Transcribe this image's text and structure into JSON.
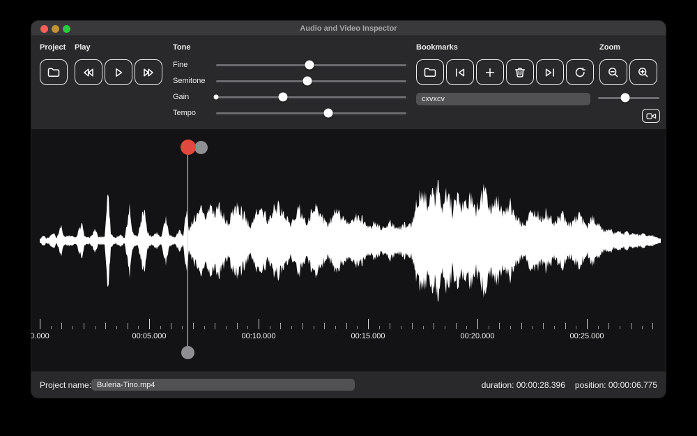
{
  "window": {
    "title": "Audio and Video Inspector"
  },
  "toolbar": {
    "project": {
      "label": "Project"
    },
    "play": {
      "label": "Play"
    },
    "tone": {
      "label": "Tone",
      "sliders": [
        {
          "name": "Fine",
          "percent": 49
        },
        {
          "name": "Semitone",
          "percent": 48
        },
        {
          "name": "Gain",
          "percent": 35,
          "min_dot": true
        },
        {
          "name": "Tempo",
          "percent": 59
        }
      ]
    },
    "bookmarks": {
      "label": "Bookmarks",
      "field_value": "cxvxcv"
    },
    "zoom": {
      "label": "Zoom",
      "slider_percent": 44
    }
  },
  "timeline": {
    "duration_seconds": 28.396,
    "position_seconds": 6.775,
    "ruler_labels": [
      {
        "time": 0,
        "label": "0.000"
      },
      {
        "time": 5,
        "label": "00:05.000"
      },
      {
        "time": 10,
        "label": "00:10.000"
      },
      {
        "time": 15,
        "label": "00:15.000"
      },
      {
        "time": 20,
        "label": "00:20.000"
      },
      {
        "time": 25,
        "label": "00:25.000"
      }
    ]
  },
  "waveform": {
    "points": [
      [
        0,
        0.03
      ],
      [
        6,
        0.1
      ],
      [
        9,
        0.04
      ],
      [
        14,
        0.06
      ],
      [
        20,
        0.16
      ],
      [
        24,
        0.05
      ],
      [
        31,
        0.28
      ],
      [
        35,
        0.07
      ],
      [
        44,
        0.1
      ],
      [
        52,
        0.05
      ],
      [
        60,
        0.33
      ],
      [
        64,
        0.08
      ],
      [
        72,
        0.06
      ],
      [
        80,
        0.2
      ],
      [
        84,
        0.06
      ],
      [
        93,
        0.08
      ],
      [
        98,
        0.95
      ],
      [
        102,
        0.12
      ],
      [
        108,
        0.06
      ],
      [
        116,
        0.1
      ],
      [
        122,
        0.06
      ],
      [
        129,
        0.58
      ],
      [
        133,
        0.14
      ],
      [
        140,
        0.07
      ],
      [
        150,
        0.62
      ],
      [
        154,
        0.16
      ],
      [
        160,
        0.07
      ],
      [
        168,
        0.14
      ],
      [
        174,
        0.06
      ],
      [
        181,
        0.44
      ],
      [
        186,
        0.1
      ],
      [
        194,
        0.07
      ],
      [
        201,
        0.18
      ],
      [
        206,
        0.08
      ],
      [
        210,
        0.55
      ],
      [
        214,
        0.2
      ],
      [
        218,
        0.3
      ],
      [
        223,
        0.42
      ],
      [
        228,
        0.5
      ],
      [
        233,
        0.56
      ],
      [
        240,
        0.48
      ],
      [
        246,
        0.6
      ],
      [
        252,
        0.5
      ],
      [
        258,
        0.62
      ],
      [
        264,
        0.44
      ],
      [
        270,
        0.3
      ],
      [
        276,
        0.5
      ],
      [
        283,
        0.64
      ],
      [
        290,
        0.55
      ],
      [
        296,
        0.38
      ],
      [
        302,
        0.26
      ],
      [
        308,
        0.42
      ],
      [
        315,
        0.58
      ],
      [
        322,
        0.52
      ],
      [
        328,
        0.35
      ],
      [
        335,
        0.56
      ],
      [
        342,
        0.66
      ],
      [
        348,
        0.54
      ],
      [
        354,
        0.4
      ],
      [
        360,
        0.3
      ],
      [
        366,
        0.5
      ],
      [
        372,
        0.6
      ],
      [
        378,
        0.46
      ],
      [
        384,
        0.34
      ],
      [
        390,
        0.52
      ],
      [
        396,
        0.64
      ],
      [
        402,
        0.5
      ],
      [
        408,
        0.38
      ],
      [
        414,
        0.3
      ],
      [
        420,
        0.44
      ],
      [
        426,
        0.56
      ],
      [
        432,
        0.46
      ],
      [
        438,
        0.34
      ],
      [
        444,
        0.28
      ],
      [
        450,
        0.38
      ],
      [
        456,
        0.48
      ],
      [
        462,
        0.4
      ],
      [
        468,
        0.3
      ],
      [
        474,
        0.24
      ],
      [
        480,
        0.32
      ],
      [
        486,
        0.28
      ],
      [
        492,
        0.22
      ],
      [
        498,
        0.28
      ],
      [
        504,
        0.34
      ],
      [
        510,
        0.26
      ],
      [
        516,
        0.22
      ],
      [
        522,
        0.3
      ],
      [
        528,
        0.26
      ],
      [
        533,
        0.3
      ],
      [
        538,
        0.55
      ],
      [
        543,
        0.74
      ],
      [
        548,
        0.95
      ],
      [
        553,
        0.8
      ],
      [
        558,
        0.62
      ],
      [
        562,
        0.92
      ],
      [
        566,
        0.74
      ],
      [
        570,
        1.0
      ],
      [
        574,
        0.84
      ],
      [
        578,
        0.62
      ],
      [
        583,
        0.92
      ],
      [
        588,
        0.8
      ],
      [
        592,
        0.52
      ],
      [
        596,
        0.86
      ],
      [
        600,
        0.74
      ],
      [
        605,
        0.56
      ],
      [
        610,
        0.72
      ],
      [
        614,
        0.62
      ],
      [
        618,
        0.78
      ],
      [
        622,
        0.68
      ],
      [
        626,
        0.52
      ],
      [
        630,
        0.7
      ],
      [
        634,
        0.8
      ],
      [
        638,
        0.88
      ],
      [
        643,
        0.72
      ],
      [
        648,
        0.58
      ],
      [
        652,
        0.68
      ],
      [
        656,
        0.76
      ],
      [
        660,
        0.62
      ],
      [
        665,
        0.48
      ],
      [
        670,
        0.6
      ],
      [
        675,
        0.68
      ],
      [
        680,
        0.52
      ],
      [
        685,
        0.4
      ],
      [
        690,
        0.32
      ],
      [
        696,
        0.26
      ],
      [
        702,
        0.44
      ],
      [
        708,
        0.56
      ],
      [
        714,
        0.5
      ],
      [
        720,
        0.38
      ],
      [
        726,
        0.5
      ],
      [
        732,
        0.44
      ],
      [
        738,
        0.32
      ],
      [
        744,
        0.4
      ],
      [
        750,
        0.46
      ],
      [
        756,
        0.36
      ],
      [
        762,
        0.28
      ],
      [
        768,
        0.38
      ],
      [
        774,
        0.44
      ],
      [
        780,
        0.34
      ],
      [
        786,
        0.26
      ],
      [
        793,
        0.4
      ],
      [
        800,
        0.3
      ],
      [
        806,
        0.22
      ],
      [
        812,
        0.16
      ],
      [
        818,
        0.24
      ],
      [
        824,
        0.14
      ],
      [
        830,
        0.18
      ],
      [
        836,
        0.12
      ],
      [
        842,
        0.16
      ],
      [
        848,
        0.1
      ],
      [
        854,
        0.14
      ],
      [
        860,
        0.1
      ],
      [
        866,
        0.13
      ],
      [
        872,
        0.08
      ],
      [
        878,
        0.1
      ],
      [
        884,
        0.06
      ],
      [
        891,
        0.04
      ]
    ]
  },
  "statusbar": {
    "project_name_label": "Project name:",
    "project_name_value": "Buleria-Tino.mp4",
    "duration_text": "duration: 00:00:28.396",
    "position_text": "position: 00:00:06.775"
  },
  "colors": {
    "accent_red": "#e2483d",
    "handle_gray": "#8e8e93",
    "waveform": "#ffffff"
  }
}
